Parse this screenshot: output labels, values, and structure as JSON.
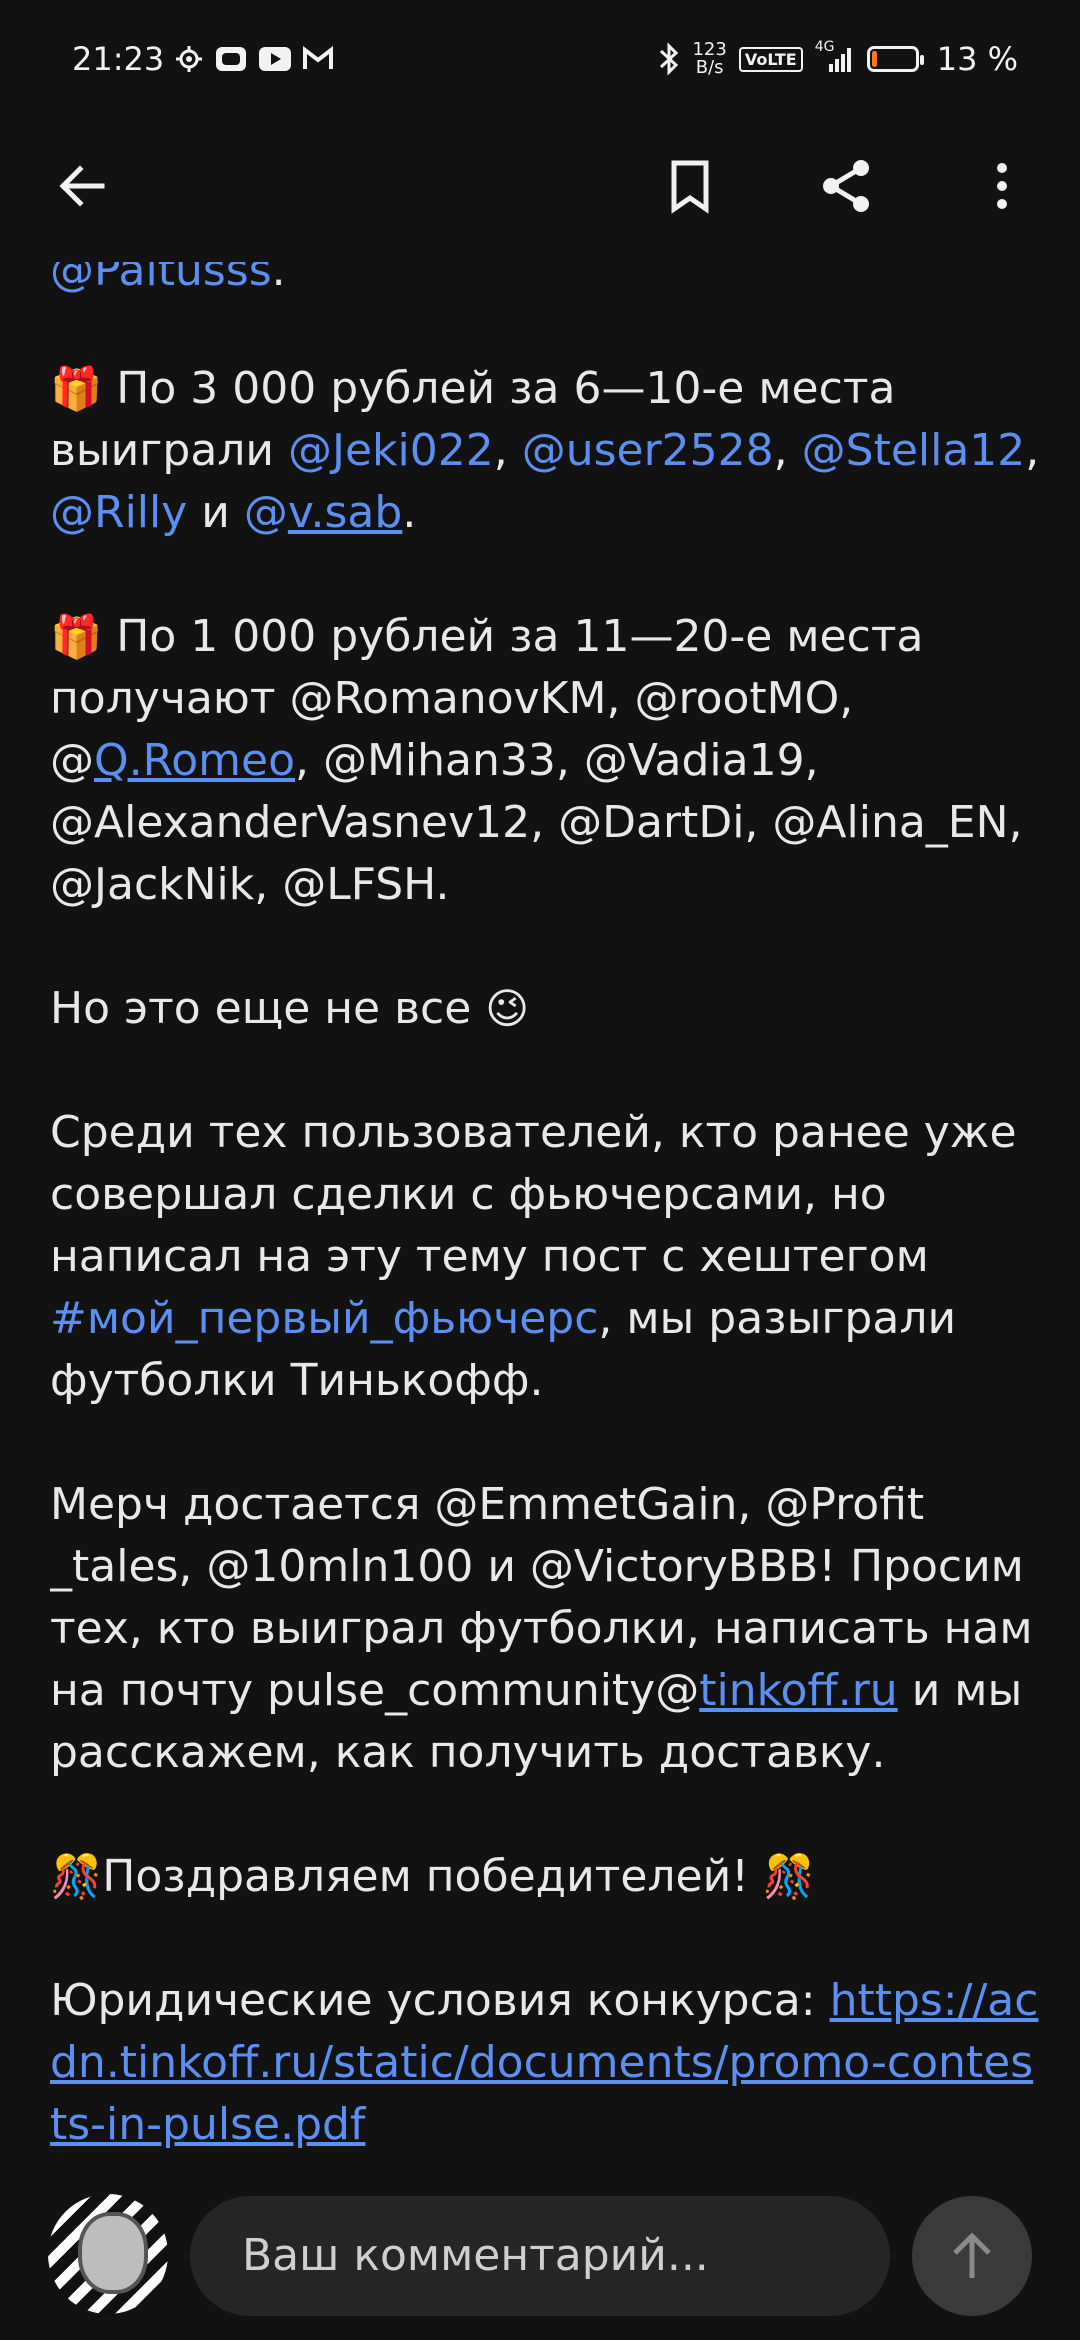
{
  "status_bar": {
    "time": "21:23",
    "net_speed_value": "123",
    "net_speed_unit": "B/s",
    "volte": "VoLTE",
    "network": "4G",
    "battery_percent": "13 %",
    "battery_level": 0.13
  },
  "comment_bar": {
    "placeholder": "Ваш комментарий..."
  },
  "post": {
    "cut_line_mention": "@Paltusss",
    "cut_line_end": ".",
    "p1": {
      "emoji": "🎁",
      "text": " По 3 000 рублей за 6—10-е места выиграли ",
      "m1": "@Jeki022",
      "s1": ", ",
      "m2": "@user2528",
      "s2": ", ",
      "m3": "@Stella12",
      "s3": ", ",
      "m4": "@Rilly",
      "s4": " и ",
      "m5_at": "@",
      "m5_name": "v.sab",
      "end": "."
    },
    "p2": {
      "emoji": "🎁",
      "text": " По 1 000 рублей за 11—20-е места получают @RomanovKM, @rootMO, ",
      "m1_at": "@",
      "m1_name": "Q.Romeo",
      "rest": ", @Mihan33, @Vadia19, @AlexanderVasnev12, @DartDi, @Alina_EN, @JackNik, @LFSH."
    },
    "p3": {
      "text": "Но это еще не все ",
      "emoji": "😉"
    },
    "p4": {
      "text1": "Среди тех пользователей, кто ранее уже совершал сделки с фьючерсами, но написал на эту тему пост с хештегом ",
      "hashtag": "#мой_первый_фьючерс",
      "text2": ", мы разыграли футболки Тинькофф."
    },
    "p5": {
      "text1": "Мерч достается @EmmetGain, @Profit _tales, @10mln100 и @VictoryBBB! Просим тех, кто выиграл футболки, написать нам на почту pulse_community@",
      "link": "tinkoff.ru",
      "text2": " и мы расскажем,  как получить доставку."
    },
    "p6": {
      "emoji1": "🎊",
      "text": "Поздравляем победителей! ",
      "emoji2": "🎊"
    },
    "p7": {
      "text": "Юридические условия конкурса: ",
      "link": "https://acdn.tinkoff.ru/static/documents/promo-contests-in-pulse.pdf"
    }
  }
}
